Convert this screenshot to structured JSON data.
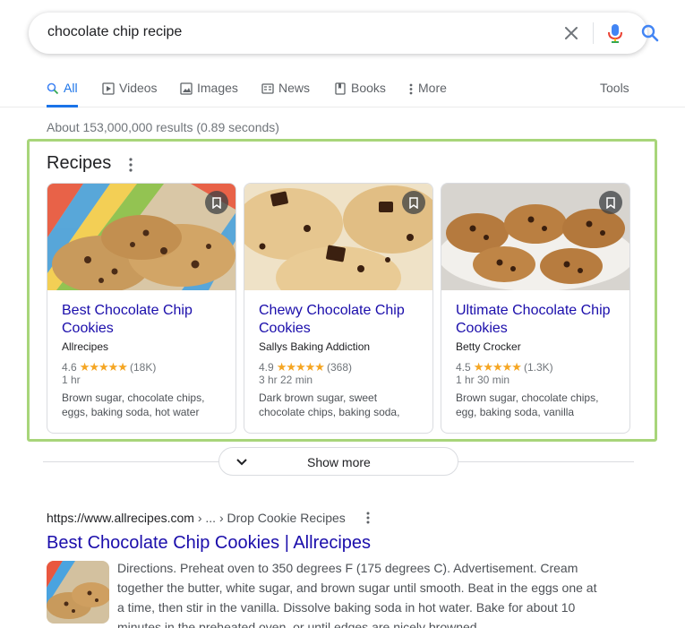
{
  "search": {
    "query": "chocolate chip recipe",
    "clear_icon": "close-icon",
    "mic_icon": "microphone-icon",
    "search_icon": "search-icon"
  },
  "tabs": [
    {
      "label": "All",
      "icon": "search-icon",
      "active": true
    },
    {
      "label": "Videos",
      "icon": "video-icon"
    },
    {
      "label": "Images",
      "icon": "image-icon"
    },
    {
      "label": "News",
      "icon": "news-icon"
    },
    {
      "label": "Books",
      "icon": "book-icon"
    },
    {
      "label": "More",
      "icon": "more-vert-icon"
    }
  ],
  "tools_label": "Tools",
  "result_stats": "About 153,000,000 results (0.89 seconds)",
  "recipes": {
    "title": "Recipes",
    "cards": [
      {
        "title": "Best Chocolate Chip Cookies",
        "source": "Allrecipes",
        "rating": "4.6",
        "stars": "★★★★★",
        "reviews": "(18K)",
        "time": "1 hr",
        "ingredients": "Brown sugar, chocolate chips, eggs, baking soda, hot water"
      },
      {
        "title": "Chewy Chocolate Chip Cookies",
        "source": "Sallys Baking Addiction",
        "rating": "4.9",
        "stars": "★★★★★",
        "reviews": "(368)",
        "time": "3 hr 22 min",
        "ingredients": "Dark brown sugar, sweet chocolate chips, baking soda,"
      },
      {
        "title": "Ultimate Chocolate Chip Cookies",
        "source": "Betty Crocker",
        "rating": "4.5",
        "stars": "★★★★★",
        "reviews": "(1.3K)",
        "time": "1 hr 30 min",
        "ingredients": "Brown sugar, chocolate chips, egg, baking soda, vanilla"
      }
    ],
    "show_more": "Show more"
  },
  "result": {
    "domain": "https://www.allrecipes.com",
    "path": " › ... › Drop Cookie Recipes",
    "title": "Best Chocolate Chip Cookies | Allrecipes",
    "snippet": "Directions. Preheat oven to 350 degrees F (175 degrees C). Advertisement. Cream together the butter, white sugar, and brown sugar until smooth. Beat in the eggs one at a time, then stir in the vanilla. Dissolve baking soda in hot water. Bake for about 10 minutes in the preheated oven, or until edges are nicely browned."
  },
  "colors": {
    "highlight_border": "#a8d57a",
    "link": "#1a0dab",
    "active_tab": "#1a73e8",
    "star": "#f5a623"
  }
}
